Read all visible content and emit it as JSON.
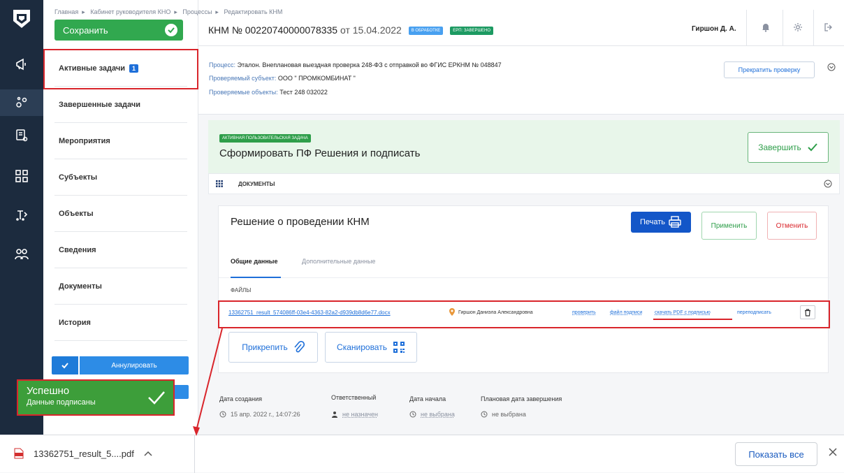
{
  "header": {
    "breadcrumbs": [
      "Главная",
      "Кабинет руководителя КНО",
      "Процессы",
      "Редактировать КНМ"
    ],
    "title_prefix": "КНМ № 00220740000078335",
    "title_date": "от 15.04.2022",
    "status_tag_1": "В ОБРАБОТКЕ",
    "status_tag_2": "ЕРП: ЗАВЕРШЕНО",
    "user_name": "Гиршон Д. А."
  },
  "left_panel": {
    "save_label": "Сохранить",
    "nav": [
      {
        "label": "Активные задачи",
        "badge": "1"
      },
      {
        "label": "Завершенные задачи"
      },
      {
        "label": "Мероприятия"
      },
      {
        "label": "Субъекты"
      },
      {
        "label": "Объекты"
      },
      {
        "label": "Сведения"
      },
      {
        "label": "Документы"
      },
      {
        "label": "История"
      }
    ],
    "annul_label": "Аннулировать"
  },
  "toast": {
    "title": "Успешно",
    "message": "Данные подписаны"
  },
  "process_info": {
    "process_label": "Процесс:",
    "process_value": "Эталон. Внеплановая выездная проверка 248-ФЗ с отправкой во ФГИС ЕРКНМ № 048847",
    "subject_label": "Проверяемый субъект:",
    "subject_value": "ООО \" ПРОМКОМБИНАТ \"",
    "objects_label": "Проверяемые объекты:",
    "objects_value": "Тест 248 032022",
    "stop_button": "Прекратить проверку"
  },
  "task": {
    "tag": "АКТИВНАЯ ПОЛЬЗОВАТЕЛЬСКАЯ ЗАДАЧА",
    "title": "Сформировать ПФ Решения и подписать",
    "finish_button": "Завершить"
  },
  "documents_bar": {
    "label": "ДОКУМЕНТЫ"
  },
  "document": {
    "title": "Решение о проведении КНМ",
    "print_button": "Печать",
    "apply_button": "Применить",
    "cancel_button": "Отменить",
    "tabs": [
      "Общие данные",
      "Дополнительные данные"
    ],
    "files_label": "ФАЙЛЫ",
    "file_name": "13362751_result_574086ff-03e4-4363-82a2-d939db8d6e77.docx",
    "signer": "Гиршон Даниэла Александровна",
    "link_check": "проверить",
    "link_sigfile": "файл подписи",
    "link_download": "скачать PDF с подписью",
    "link_resign": "переподписать",
    "attach_button": "Прикрепить",
    "scan_button": "Сканировать"
  },
  "meta": {
    "created_label": "Дата создания",
    "created_value": "15 апр. 2022 г., 14:07:26",
    "responsible_label": "Ответственный",
    "responsible_value": "не назначен",
    "start_label": "Дата начала",
    "start_value": "не выбрана",
    "planned_end_label": "Плановая дата завершения",
    "planned_end_value": "не выбрана"
  },
  "download_bar": {
    "file_name": "13362751_result_5....pdf",
    "show_all": "Показать все"
  },
  "colors": {
    "rail": "#1c2b3e",
    "save_green": "#31a84f",
    "accent_blue": "#1e6fd9",
    "annotation_red": "#d9252b",
    "toast_green": "#3d9e3a"
  },
  "icons": [
    "shield-logo-icon",
    "megaphone-icon",
    "gears-icon",
    "document-search-icon",
    "grid-icon",
    "hierarchy-icon",
    "users-icon",
    "bell-icon",
    "gear-icon",
    "logout-icon",
    "chevron-down-icon",
    "printer-icon",
    "paperclip-icon",
    "qr-icon",
    "trash-icon",
    "clock-icon",
    "person-icon",
    "pin-icon",
    "pdf-icon",
    "close-icon"
  ]
}
